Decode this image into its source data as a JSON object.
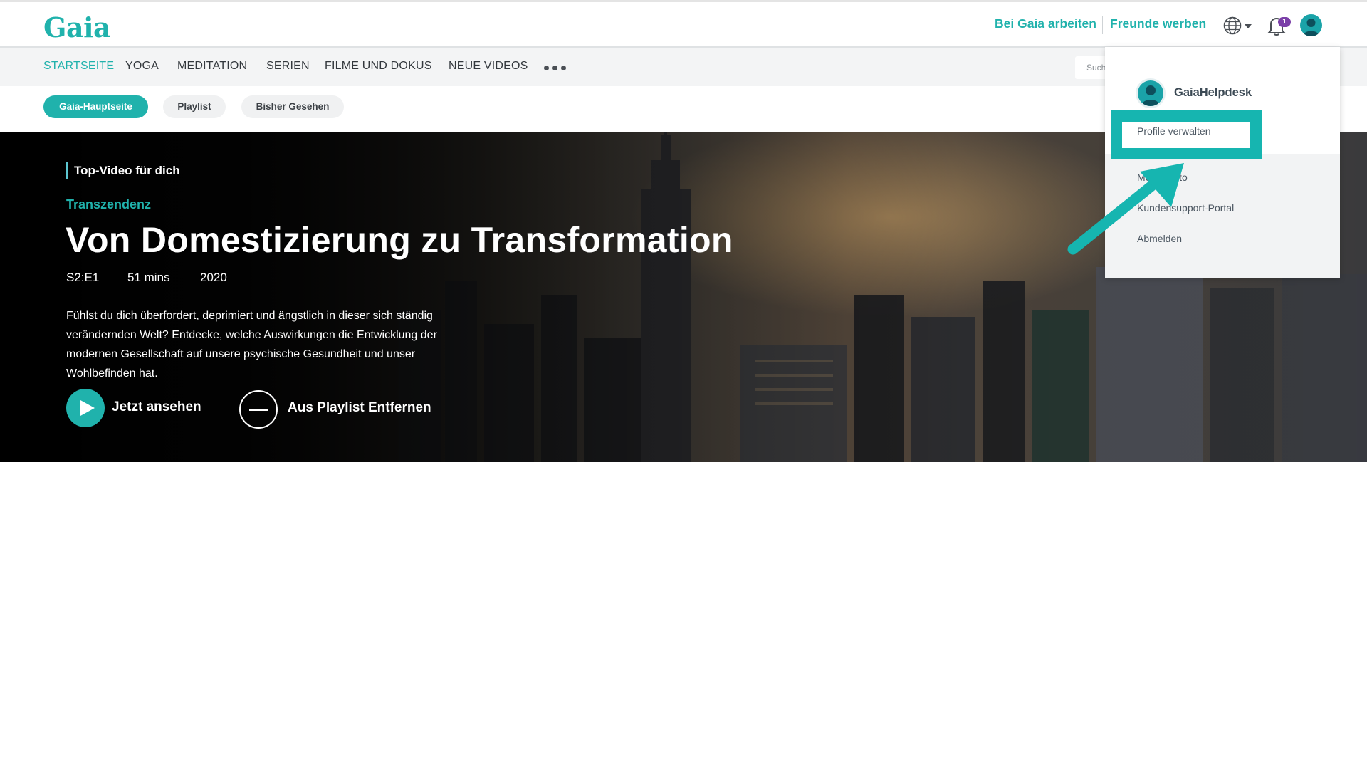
{
  "brand": {
    "logo": "Gaia",
    "accent": "#20b2ac"
  },
  "header": {
    "links": [
      "Bei Gaia arbeiten",
      "Freunde werben"
    ],
    "notification_count": "1",
    "icons": [
      "globe-icon",
      "bell-icon",
      "avatar"
    ]
  },
  "nav": {
    "items": [
      "STARTSEITE",
      "YOGA",
      "MEDITATION",
      "SERIEN",
      "FILME UND DOKUS",
      "NEUE VIDEOS"
    ],
    "active": "STARTSEITE",
    "search_placeholder": "Such"
  },
  "chips": [
    "Gaia-Hauptseite",
    "Playlist",
    "Bisher Gesehen"
  ],
  "hero": {
    "tag": "Top-Video für dich",
    "series": "Transzendenz",
    "title": "Von Domestizierung zu Transformation",
    "episode": "S2:E1",
    "duration": "51 mins",
    "year": "2020",
    "description": "Fühlst du dich überfordert, deprimiert und ängstlich in dieser sich ständig verändernden Welt? Entdecke, welche Auswirkungen die Entwicklung der modernen Gesellschaft auf unsere psychische Gesundheit und unser Wohlbefinden hat.",
    "watch_label": "Jetzt ansehen",
    "remove_label": "Aus Playlist Entfernen"
  },
  "profile_menu": {
    "username": "GaiaHelpdesk",
    "manage_profiles": "Profile verwalten",
    "items": [
      "Mein Konto",
      "Kundensupport-Portal",
      "Abmelden"
    ]
  }
}
